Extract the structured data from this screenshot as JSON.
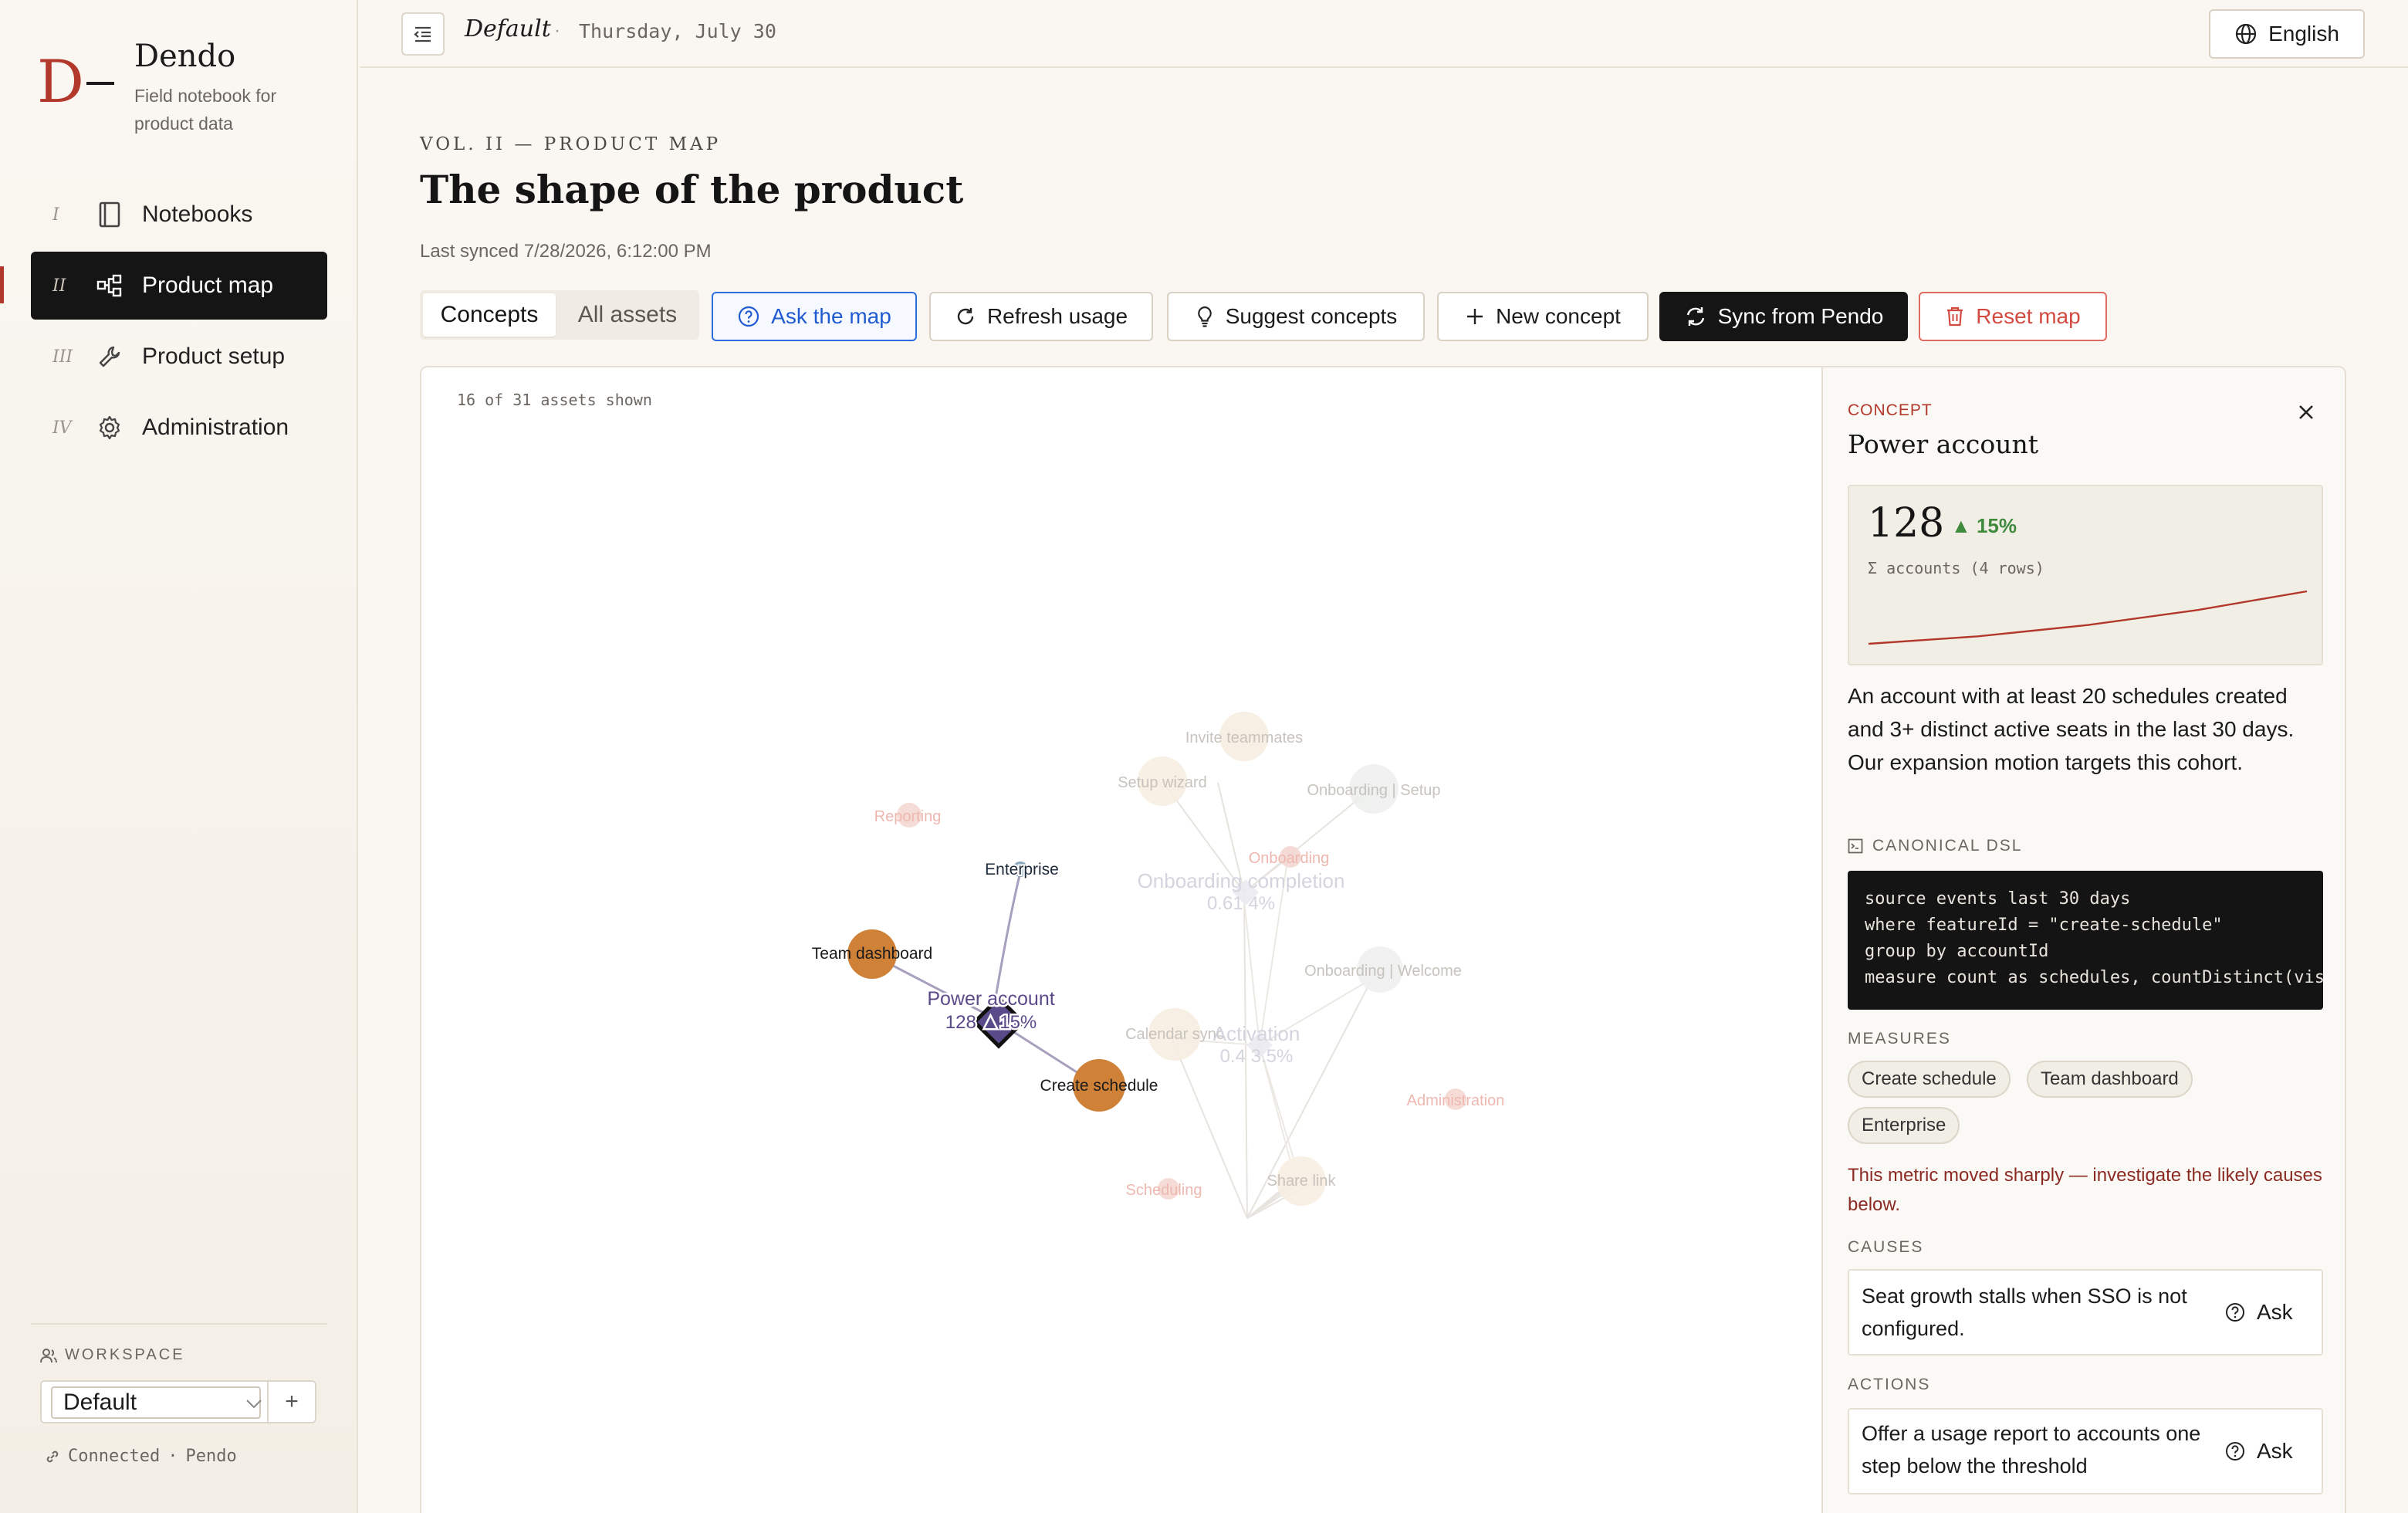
{
  "brand": {
    "mark": "D",
    "name": "Dendo",
    "tagline": "Field notebook for product data"
  },
  "nav": {
    "items": [
      {
        "num": "I",
        "label": "Notebooks",
        "icon": "notebook-icon"
      },
      {
        "num": "II",
        "label": "Product map",
        "icon": "map-tree-icon",
        "active": true
      },
      {
        "num": "III",
        "label": "Product setup",
        "icon": "wrench-icon"
      },
      {
        "num": "IV",
        "label": "Administration",
        "icon": "gear-icon"
      }
    ]
  },
  "workspace": {
    "title": "WORKSPACE",
    "selected": "Default",
    "add_label": "+",
    "status": "Connected",
    "source": "Pendo"
  },
  "topbar": {
    "workspace": "Default",
    "separator": "·",
    "date": "Thursday, July 30",
    "language": "English"
  },
  "header": {
    "eyebrow": "VOL. II — PRODUCT MAP",
    "title": "The shape of the product",
    "synced": "Last synced 7/28/2026, 6:12:00 PM"
  },
  "toolbar": {
    "tabs": [
      {
        "label": "Concepts",
        "active": true
      },
      {
        "label": "All assets"
      }
    ],
    "ask": "Ask the map",
    "refresh": "Refresh usage",
    "suggest": "Suggest concepts",
    "new_concept": "New concept",
    "sync": "Sync from Pendo",
    "reset": "Reset map"
  },
  "map": {
    "asset_count": "16 of 31 assets shown",
    "nodes": [
      {
        "id": "power",
        "label": "Power account",
        "sub": "128 ▲15%",
        "kind": "concept",
        "emphasis": "focus"
      },
      {
        "id": "team",
        "label": "Team dashboard",
        "kind": "feature",
        "emphasis": "active"
      },
      {
        "id": "create",
        "label": "Create schedule",
        "kind": "feature",
        "emphasis": "active"
      },
      {
        "id": "enterprise",
        "label": "Enterprise",
        "kind": "segment",
        "emphasis": "active"
      },
      {
        "id": "reporting",
        "label": "Reporting",
        "kind": "group",
        "emphasis": "faded"
      },
      {
        "id": "invite",
        "label": "Invite teammates",
        "kind": "feature",
        "emphasis": "faded"
      },
      {
        "id": "wizard",
        "label": "Setup wizard",
        "kind": "feature",
        "emphasis": "faded"
      },
      {
        "id": "onb_setup",
        "label": "Onboarding | Setup",
        "kind": "page",
        "emphasis": "faded"
      },
      {
        "id": "onboarding",
        "label": "Onboarding",
        "kind": "group",
        "emphasis": "faded"
      },
      {
        "id": "onb_comp",
        "label": "Onboarding completion",
        "sub": "0.61 4%",
        "kind": "concept",
        "emphasis": "faded"
      },
      {
        "id": "onb_welcome",
        "label": "Onboarding | Welcome",
        "kind": "page",
        "emphasis": "faded"
      },
      {
        "id": "calendar",
        "label": "Calendar sync",
        "kind": "feature",
        "emphasis": "faded"
      },
      {
        "id": "activation",
        "label": "Activation",
        "sub": "0.4 3.5%",
        "kind": "concept",
        "emphasis": "faded"
      },
      {
        "id": "admin",
        "label": "Administration",
        "kind": "group",
        "emphasis": "faded"
      },
      {
        "id": "scheduling",
        "label": "Scheduling",
        "kind": "group",
        "emphasis": "faded"
      },
      {
        "id": "share",
        "label": "Share link",
        "kind": "feature",
        "emphasis": "faded"
      }
    ]
  },
  "detail": {
    "kicker": "CONCEPT",
    "title": "Power account",
    "metric": {
      "value": "128",
      "delta": "▲ 15%",
      "sub": "Σ accounts (4 rows)",
      "trend": [
        4,
        8,
        14,
        22,
        32
      ]
    },
    "description": "An account with at least 20 schedules created and 3+ distinct active seats in the last 30 days. Our expansion motion targets this cohort.",
    "dsl_label": "CANONICAL DSL",
    "dsl": [
      "source events last 30 days",
      "where featureId = \"create-schedule\"",
      "group by accountId",
      "measure count as schedules, countDistinct(visitorId) as seats"
    ],
    "measures_label": "MEASURES",
    "measures": [
      "Create schedule",
      "Team dashboard",
      "Enterprise"
    ],
    "alert": "This metric moved sharply — investigate the likely causes below.",
    "causes_label": "CAUSES",
    "causes": [
      {
        "text": "Seat growth stalls when SSO is not configured.",
        "action": "Ask"
      }
    ],
    "actions_label": "ACTIONS",
    "actions": [
      {
        "text": "Offer a usage report to accounts one step below the threshold",
        "action": "Ask"
      }
    ]
  },
  "colors": {
    "accent": "#b3382c",
    "feature_node": "#cf8138",
    "concept_node": "#5b4a8a",
    "segment_node": "#6d8fa8",
    "positive": "#3f8a3c",
    "link": "#2d6cdf"
  }
}
